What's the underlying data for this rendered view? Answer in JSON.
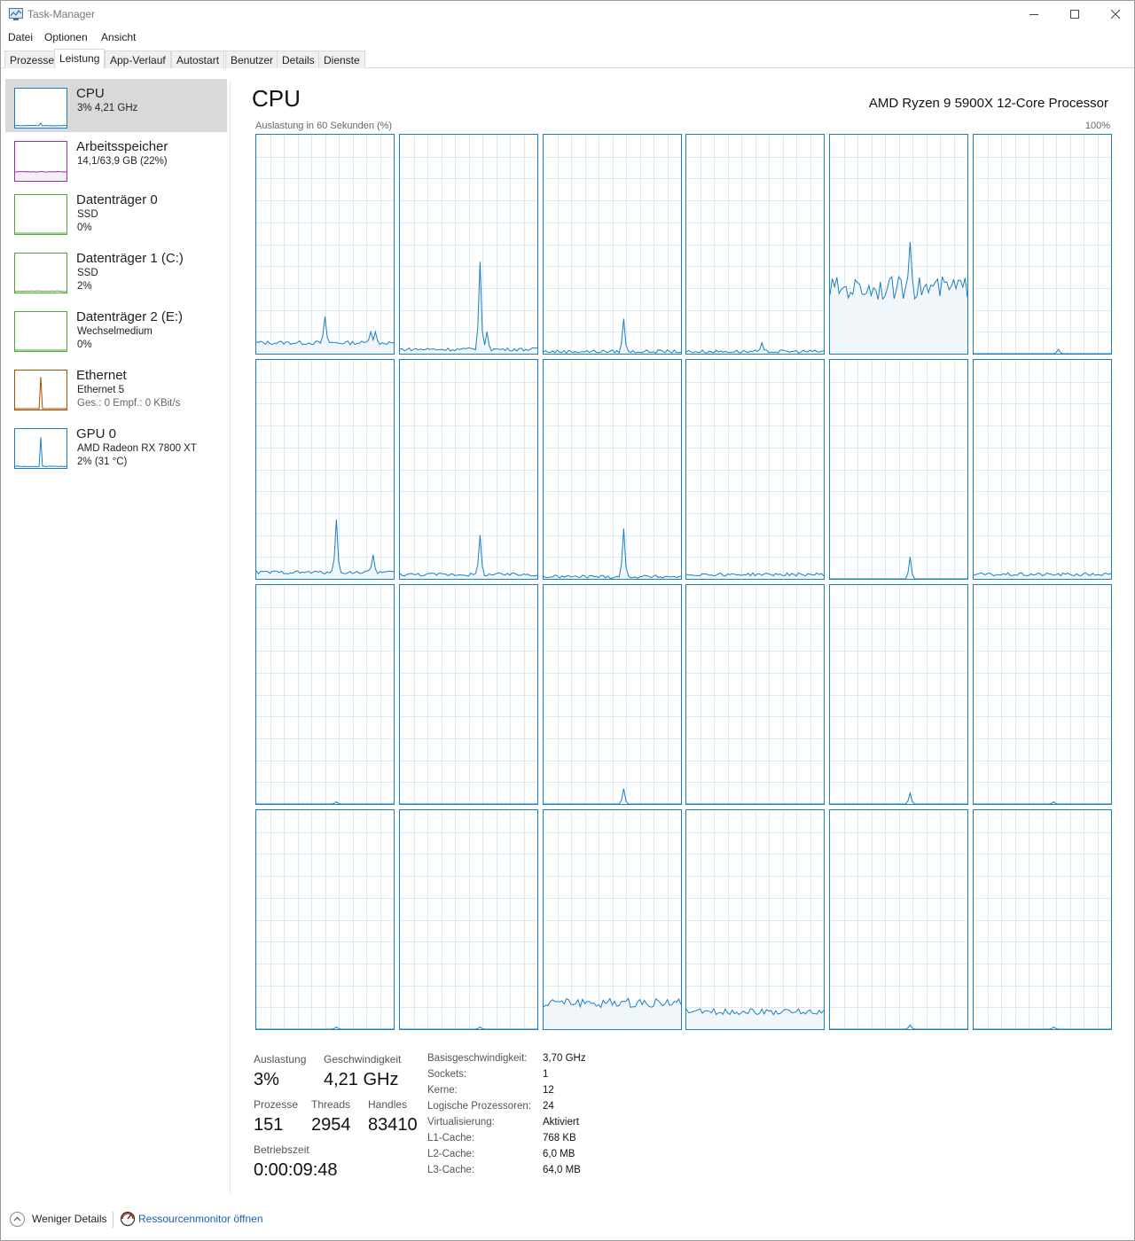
{
  "window": {
    "title": "Task-Manager"
  },
  "menu": [
    "Datei",
    "Optionen",
    "Ansicht"
  ],
  "tabs": [
    "Prozesse",
    "Leistung",
    "App-Verlauf",
    "Autostart",
    "Benutzer",
    "Details",
    "Dienste"
  ],
  "active_tab": "Leistung",
  "sidebar": [
    {
      "title": "CPU",
      "line1": "3% 4,21 GHz",
      "line2": "",
      "color": "#1b7ec2",
      "selected": true
    },
    {
      "title": "Arbeitsspeicher",
      "line1": "14,1/63,9 GB (22%)",
      "line2": "",
      "color": "#9b2fae",
      "selected": false
    },
    {
      "title": "Datenträger 0",
      "line1": "SSD",
      "line2": "0%",
      "color": "#4da732",
      "selected": false
    },
    {
      "title": "Datenträger 1 (C:)",
      "line1": "SSD",
      "line2": "2%",
      "color": "#4da732",
      "selected": false
    },
    {
      "title": "Datenträger 2 (E:)",
      "line1": "Wechselmedium",
      "line2": "0%",
      "color": "#4da732",
      "selected": false
    },
    {
      "title": "Ethernet",
      "line1": "Ethernet 5",
      "line2": "Ges.: 0 Empf.: 0 KBit/s",
      "color": "#a74f01",
      "selected": false
    },
    {
      "title": "GPU 0",
      "line1": "AMD Radeon RX 7800 XT",
      "line2": "2% (31 °C)",
      "color": "#1b7ec2",
      "selected": false
    }
  ],
  "cpu": {
    "heading": "CPU",
    "model": "AMD Ryzen 9 5900X 12-Core Processor",
    "graph_label": "Auslastung in 60 Sekunden (%)",
    "graph_max": "100%",
    "stats": {
      "auslastung_label": "Auslastung",
      "auslastung": "3%",
      "geschwindigkeit_label": "Geschwindigkeit",
      "geschwindigkeit": "4,21 GHz",
      "prozesse_label": "Prozesse",
      "prozesse": "151",
      "threads_label": "Threads",
      "threads": "2954",
      "handles_label": "Handles",
      "handles": "83410",
      "betriebszeit_label": "Betriebszeit",
      "betriebszeit": "0:00:09:48"
    },
    "details": [
      {
        "k": "Basisgeschwindigkeit:",
        "v": "3,70 GHz"
      },
      {
        "k": "Sockets:",
        "v": "1"
      },
      {
        "k": "Kerne:",
        "v": "12"
      },
      {
        "k": "Logische Prozessoren:",
        "v": "24"
      },
      {
        "k": "Virtualisierung:",
        "v": "Aktiviert"
      },
      {
        "k": "L1-Cache:",
        "v": "768 KB"
      },
      {
        "k": "L2-Cache:",
        "v": "6,0 MB"
      },
      {
        "k": "L3-Cache:",
        "v": "64,0 MB"
      }
    ]
  },
  "core_usage_percent": [
    {
      "base": 5,
      "peaks": [
        [
          30,
          17
        ],
        [
          50,
          10
        ],
        [
          52,
          10
        ]
      ]
    },
    {
      "base": 2,
      "peaks": [
        [
          35,
          42
        ],
        [
          38,
          10
        ]
      ]
    },
    {
      "base": 1,
      "peaks": [
        [
          35,
          16
        ]
      ]
    },
    {
      "base": 1,
      "peaks": [
        [
          33,
          5
        ]
      ]
    },
    {
      "base": 30,
      "peaks": [
        [
          35,
          51
        ]
      ]
    },
    {
      "base": 0,
      "peaks": [
        [
          37,
          2
        ]
      ]
    },
    {
      "base": 3,
      "peaks": [
        [
          35,
          27
        ],
        [
          51,
          11
        ]
      ]
    },
    {
      "base": 2,
      "peaks": [
        [
          35,
          20
        ]
      ]
    },
    {
      "base": 1,
      "peaks": [
        [
          35,
          23
        ]
      ]
    },
    {
      "base": 2,
      "peaks": []
    },
    {
      "base": 0,
      "peaks": [
        [
          35,
          10
        ]
      ]
    },
    {
      "base": 2,
      "peaks": []
    },
    {
      "base": 0,
      "peaks": [
        [
          35,
          1
        ]
      ]
    },
    {
      "base": 0,
      "peaks": []
    },
    {
      "base": 0,
      "peaks": [
        [
          35,
          7
        ]
      ]
    },
    {
      "base": 0,
      "peaks": []
    },
    {
      "base": 0,
      "peaks": [
        [
          35,
          5
        ]
      ]
    },
    {
      "base": 0,
      "peaks": [
        [
          35,
          1
        ]
      ]
    },
    {
      "base": 0,
      "peaks": [
        [
          35,
          1
        ]
      ]
    },
    {
      "base": 0,
      "peaks": [
        [
          35,
          1
        ]
      ]
    },
    {
      "base": 12,
      "peaks": []
    },
    {
      "base": 8,
      "peaks": []
    },
    {
      "base": 0,
      "peaks": [
        [
          35,
          2
        ]
      ]
    },
    {
      "base": 0,
      "peaks": [
        [
          35,
          1
        ]
      ]
    }
  ],
  "footer": {
    "less_details": "Weniger Details",
    "resource_monitor": "Ressourcenmonitor öffnen"
  }
}
